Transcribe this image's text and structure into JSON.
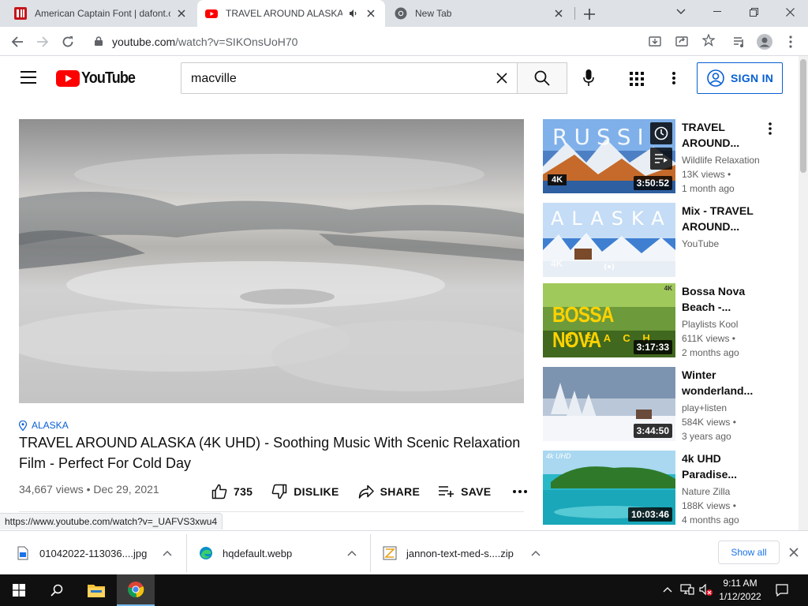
{
  "browser": {
    "tabs": [
      {
        "title": "American Captain Font | dafont.c",
        "icon": "dafont-icon",
        "active": false
      },
      {
        "title": "TRAVEL AROUND ALASKA (4",
        "icon": "youtube-icon",
        "active": true,
        "audio": true
      },
      {
        "title": "New Tab",
        "icon": "chrome-icon",
        "active": false
      }
    ],
    "url_host": "youtube.com",
    "url_path": "/watch?v=SIKOnsUoH70"
  },
  "youtube": {
    "logo_text": "YouTube",
    "search_query": "macville",
    "signin_label": "SIGN IN"
  },
  "video": {
    "location": "ALASKA",
    "title": "TRAVEL AROUND ALASKA (4K UHD) - Soothing Music With Scenic Relaxation Film - Perfect For Cold Day",
    "meta": "34,667 views • Dec 29, 2021",
    "likes": "735",
    "dislike_label": "DISLIKE",
    "share_label": "SHARE",
    "save_label": "SAVE"
  },
  "recommendations": [
    {
      "title": "TRAVEL AROUND...",
      "channel": "Wildlife Relaxation",
      "views": "13K views •",
      "age": "1 month ago",
      "duration": "3:50:52",
      "thumb_text": "RUSSI",
      "badge": "4K"
    },
    {
      "title": "Mix - TRAVEL AROUND...",
      "channel": "YouTube",
      "views": "",
      "age": "",
      "duration": "",
      "thumb_text": "ALASKA",
      "badge": "4K"
    },
    {
      "title": "Bossa Nova Beach -...",
      "channel": "Playlists Kool",
      "views": "611K views •",
      "age": "2 months ago",
      "duration": "3:17:33",
      "thumb_text": "BOSSA NOVA",
      "thumb_sub": "B E A C H",
      "badge": "4K"
    },
    {
      "title": "Winter wonderland...",
      "channel": "play+listen",
      "views": "584K views •",
      "age": "3 years ago",
      "duration": "3:44:50",
      "thumb_text": "",
      "badge": ""
    },
    {
      "title": "4k UHD Paradise...",
      "channel": "Nature Zilla",
      "views": "188K views •",
      "age": "4 months ago",
      "duration": "10:03:46",
      "thumb_text": "4k UHD",
      "badge": ""
    }
  ],
  "status_url": "https://www.youtube.com/watch?v=_UAFVS3xwu4",
  "downloads": [
    {
      "name": "01042022-113036....jpg",
      "icon": "image-file-icon"
    },
    {
      "name": "hqdefault.webp",
      "icon": "edge-icon"
    },
    {
      "name": "jannon-text-med-s....zip",
      "icon": "zip-file-icon"
    }
  ],
  "downloads_show_all": "Show all",
  "taskbar": {
    "time": "9:11 AM",
    "date": "1/12/2022"
  },
  "colors": {
    "youtube_red": "#ff0000",
    "link_blue": "#065fd4",
    "taskbar": "#101010"
  }
}
